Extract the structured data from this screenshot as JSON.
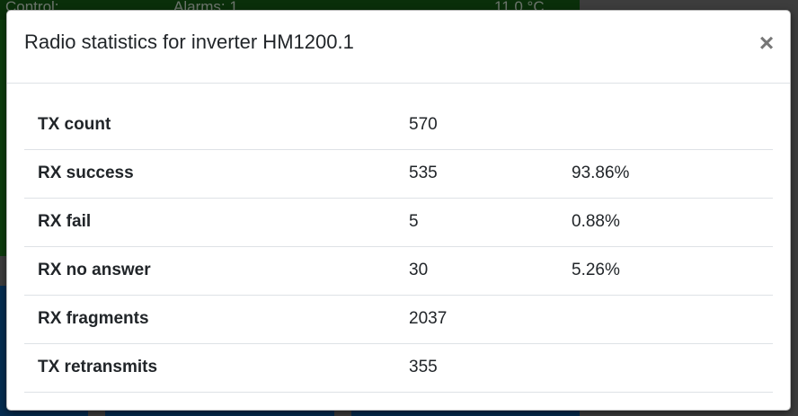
{
  "background": {
    "header_left": "Control:",
    "header_mid": "Alarms: 1",
    "header_right": "11.0 °C"
  },
  "modal": {
    "title": "Radio statistics for inverter HM1200.1",
    "close_symbol": "×"
  },
  "stats": [
    {
      "label": "TX count",
      "value": "570",
      "percent": ""
    },
    {
      "label": "RX success",
      "value": "535",
      "percent": "93.86%"
    },
    {
      "label": "RX fail",
      "value": "5",
      "percent": "0.88%"
    },
    {
      "label": "RX no answer",
      "value": "30",
      "percent": "5.26%"
    },
    {
      "label": "RX fragments",
      "value": "2037",
      "percent": ""
    },
    {
      "label": "TX retransmits",
      "value": "355",
      "percent": ""
    }
  ],
  "colors": {
    "background_green": "#1d7a1d",
    "background_blue": "#0b5aa3"
  }
}
